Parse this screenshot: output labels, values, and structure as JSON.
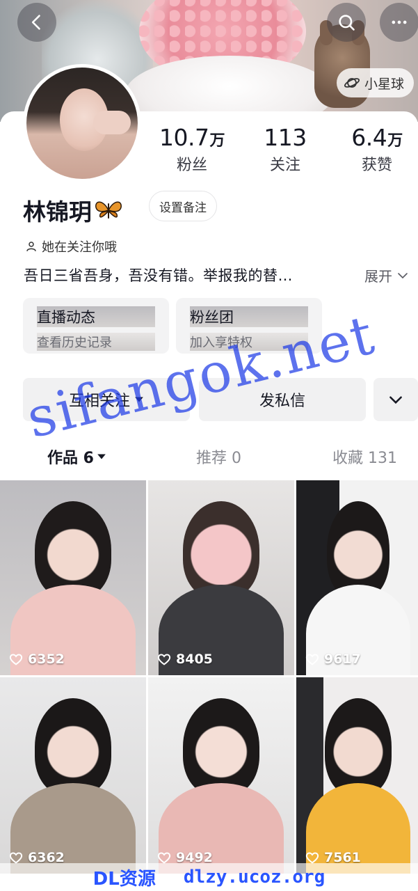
{
  "header": {
    "planet_label": "小星球"
  },
  "profile": {
    "name": "林锦玥",
    "remark_button": "设置备注",
    "follows_you_text": "她在关注你哦",
    "bio": "吾日三省吾身，吾没有错。举报我的替…",
    "expand_label": "展开"
  },
  "stats": {
    "fans": {
      "value": "10.7",
      "unit": "万",
      "label": "粉丝"
    },
    "following": {
      "value": "113",
      "label": "关注"
    },
    "likes": {
      "value": "6.4",
      "unit": "万",
      "label": "获赞"
    }
  },
  "cards": [
    {
      "title": "直播动态",
      "subtitle": "查看历史记录"
    },
    {
      "title": "粉丝团",
      "subtitle": "加入享特权"
    }
  ],
  "actions": {
    "mutual_follow": "互相关注",
    "message": "发私信"
  },
  "tabs": [
    {
      "label": "作品 6"
    },
    {
      "label": "推荐 0"
    },
    {
      "label": "收藏 131"
    }
  ],
  "videos": [
    {
      "likes": "6352"
    },
    {
      "likes": "8405"
    },
    {
      "likes": "9617"
    },
    {
      "likes": "6362"
    },
    {
      "likes": "9492"
    },
    {
      "likes": "7561"
    }
  ],
  "watermarks": {
    "main": "sifangok.net",
    "footer_cn": "DL资源",
    "footer_site": "dlzy.ucoz.org"
  },
  "colors": {
    "brand_text": "#161823",
    "watermark_blue": "#2a55ff",
    "chip_bg": "#f3f3f4"
  }
}
